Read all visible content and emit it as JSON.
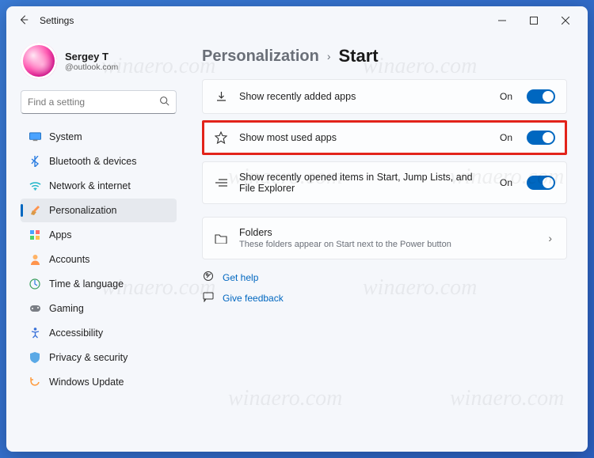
{
  "window": {
    "title": "Settings"
  },
  "user": {
    "name": "Sergey T",
    "email": "@outlook.com"
  },
  "search": {
    "placeholder": "Find a setting"
  },
  "sidebar": {
    "items": [
      {
        "label": "System"
      },
      {
        "label": "Bluetooth & devices"
      },
      {
        "label": "Network & internet"
      },
      {
        "label": "Personalization"
      },
      {
        "label": "Apps"
      },
      {
        "label": "Accounts"
      },
      {
        "label": "Time & language"
      },
      {
        "label": "Gaming"
      },
      {
        "label": "Accessibility"
      },
      {
        "label": "Privacy & security"
      },
      {
        "label": "Windows Update"
      }
    ],
    "active_index": 3
  },
  "breadcrumb": {
    "parent": "Personalization",
    "separator": "›",
    "current": "Start"
  },
  "settings": [
    {
      "label": "Show recently added apps",
      "state": "On"
    },
    {
      "label": "Show most used apps",
      "state": "On",
      "highlight": true
    },
    {
      "label": "Show recently opened items in Start, Jump Lists, and File Explorer",
      "state": "On"
    }
  ],
  "folders": {
    "title": "Folders",
    "subtitle": "These folders appear on Start next to the Power button"
  },
  "help": {
    "get_help": "Get help",
    "give_feedback": "Give feedback"
  },
  "watermark": "winaero.com"
}
